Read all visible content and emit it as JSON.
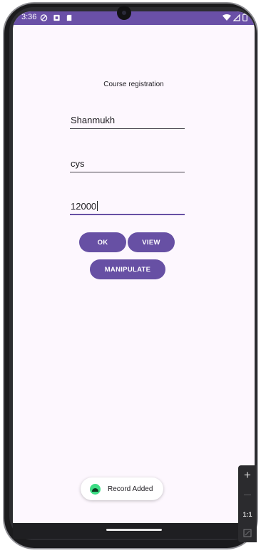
{
  "status_bar": {
    "time": "3:36",
    "color": "#6a50a7",
    "left_icons": [
      "vpn-icon",
      "notification-icon",
      "sd-card-icon"
    ],
    "right_icons": [
      "wifi-icon",
      "signal-icon",
      "battery-icon"
    ]
  },
  "app": {
    "title": "Course registration",
    "background": "#fdf7fe",
    "accent": "#6750a4"
  },
  "form": {
    "name_value": "Shanmukh",
    "course_value": "cys",
    "fee_value": "12000"
  },
  "buttons": {
    "ok_label": "OK",
    "view_label": "VIEW",
    "manipulate_label": "MANIPULATE"
  },
  "toast": {
    "icon": "android-icon",
    "message": "Record Added"
  },
  "emulator_toolbar": {
    "zoom_in_label": "+",
    "zoom_out_label": "—",
    "actual_size_label": "1:1",
    "fit_icon": "fit-screen-icon"
  }
}
